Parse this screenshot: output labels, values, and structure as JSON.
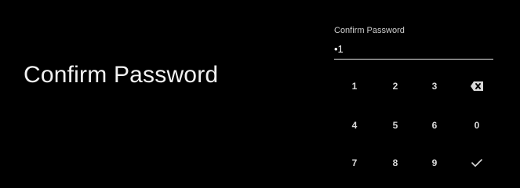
{
  "main": {
    "title": "Confirm Password"
  },
  "input": {
    "label": "Confirm Password",
    "value": "•1"
  },
  "keypad": {
    "row1": [
      "1",
      "2",
      "3"
    ],
    "row2": [
      "4",
      "5",
      "6",
      "0"
    ],
    "row3": [
      "7",
      "8",
      "9"
    ],
    "icons": {
      "backspace": "backspace-icon",
      "confirm": "checkmark-icon"
    }
  },
  "colors": {
    "background": "#000000",
    "text": "#ffffff",
    "key_text": "#d9d9d9"
  }
}
